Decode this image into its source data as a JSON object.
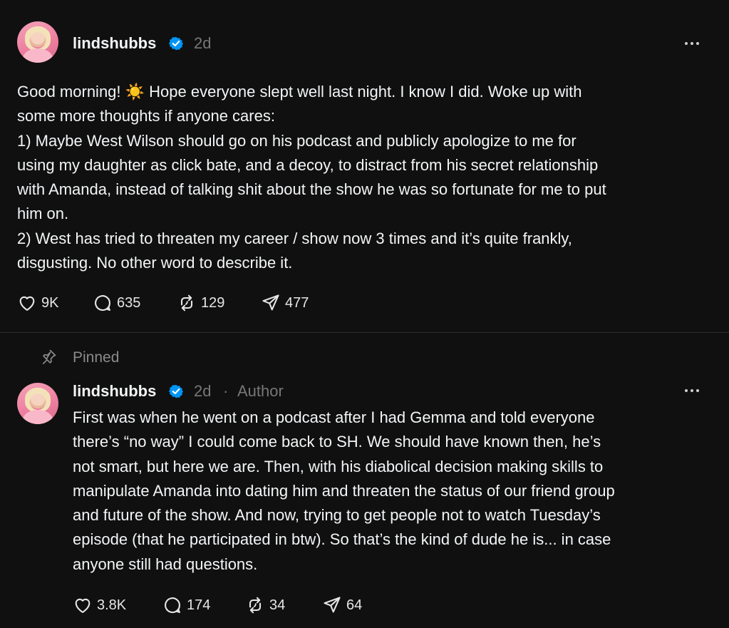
{
  "posts": [
    {
      "username": "lindshubbs",
      "time": "2d",
      "text": "Good morning! ☀️ Hope everyone slept well last night. I know I did. Woke up with\nsome more thoughts if anyone cares:\n1) Maybe West Wilson should go on his podcast and publicly apologize to me for\nusing my daughter as click bate, and a decoy, to distract from his secret relationship\nwith Amanda, instead of talking shit about the show he was so fortunate for me to put\nhim on.\n2) West has tried to threaten my career / show now 3 times and it’s quite frankly,\ndisgusting. No other word to describe it.",
      "likes": "9K",
      "replies": "635",
      "reposts": "129",
      "shares": "477"
    },
    {
      "pinned_label": "Pinned",
      "username": "lindshubbs",
      "time": "2d",
      "separator": "·",
      "author_label": "Author",
      "text": "First was when he went on a podcast after I had Gemma and told everyone\nthere’s “no way” I could come back to SH. We should have known then, he’s\nnot smart, but here we are. Then, with his diabolical decision making skills to\nmanipulate Amanda into dating him and threaten the status of our friend group\nand future of the show. And now, trying to get people not to watch Tuesday’s\nepisode (that he participated in btw). So that’s the kind of dude he is... in case\nanyone still had questions.",
      "likes": "3.8K",
      "replies": "174",
      "reposts": "34",
      "shares": "64"
    }
  ],
  "colors": {
    "background": "#101010",
    "text": "#f3f5f7",
    "muted": "#777777",
    "verified": "#0095f6",
    "divider": "#2e2e2e"
  },
  "icons": [
    "verified-badge-icon",
    "more-icon",
    "heart-icon",
    "comment-icon",
    "repost-icon",
    "share-icon",
    "pin-icon"
  ]
}
